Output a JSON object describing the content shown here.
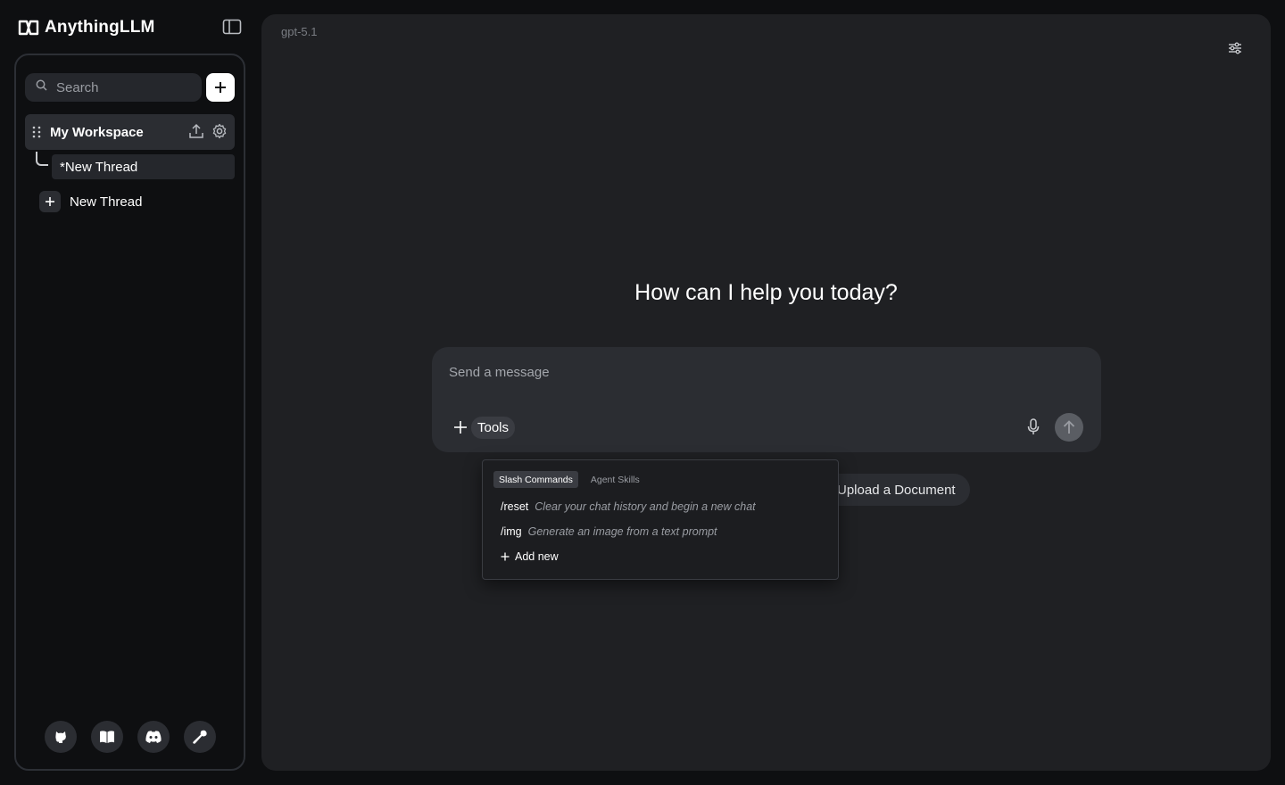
{
  "brand": {
    "name": "AnythingLLM",
    "icon": "anythingllm-logo-icon"
  },
  "sidebar": {
    "search": {
      "placeholder": "Search"
    },
    "workspace": {
      "name": "My Workspace"
    },
    "thread": {
      "label": "*New Thread"
    },
    "new_thread_label": "New Thread",
    "footer_icons": [
      "github-icon",
      "book-icon",
      "discord-icon",
      "wrench-icon"
    ]
  },
  "main": {
    "model": "gpt-5.1",
    "headline": "How can I help you today?",
    "composer": {
      "placeholder": "Send a message",
      "tools_label": "Tools"
    },
    "upload_label": "Upload a Document",
    "popup": {
      "tabs": [
        "Slash Commands",
        "Agent Skills"
      ],
      "commands": [
        {
          "name": "/reset",
          "desc": "Clear your chat history and begin a new chat"
        },
        {
          "name": "/img",
          "desc": "Generate an image from a text prompt"
        }
      ],
      "add_new_label": "Add new"
    }
  },
  "colors": {
    "background": "#0e0f11",
    "panel": "#1f2023",
    "composer": "#2b2d32",
    "muted_text": "#9a9da3"
  }
}
